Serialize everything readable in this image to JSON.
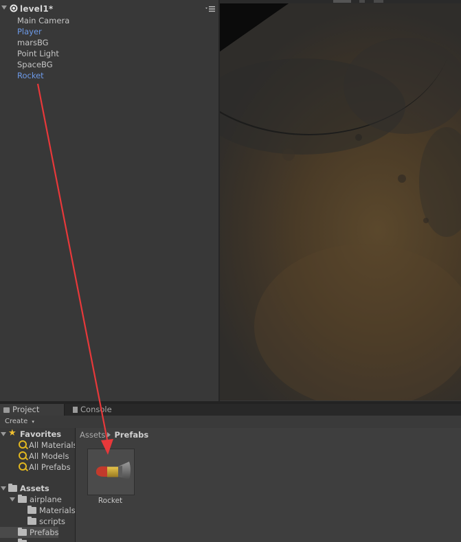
{
  "hierarchy": {
    "scene_title": "level1*",
    "menu_icon": "dropdown-menu-icon",
    "items": [
      {
        "label": "Main Camera",
        "kind": "normal"
      },
      {
        "label": "Player",
        "kind": "prefab"
      },
      {
        "label": "marsBG",
        "kind": "normal"
      },
      {
        "label": "Point Light",
        "kind": "normal"
      },
      {
        "label": "SpaceBG",
        "kind": "normal"
      },
      {
        "label": "Rocket",
        "kind": "prefab"
      }
    ]
  },
  "tabs": {
    "project": "Project",
    "console": "Console"
  },
  "toolbar": {
    "create": "Create"
  },
  "favorites": {
    "label": "Favorites",
    "items": [
      "All Materials",
      "All Models",
      "All Prefabs"
    ]
  },
  "assets": {
    "label": "Assets",
    "children": [
      {
        "label": "airplane"
      },
      {
        "label": "Materials"
      },
      {
        "label": "scripts"
      },
      {
        "label": "Prefabs"
      }
    ]
  },
  "breadcrumb": {
    "root": "Assets",
    "current": "Prefabs"
  },
  "asset_grid": {
    "items": [
      {
        "label": "Rocket"
      }
    ]
  },
  "colors": {
    "prefab_text": "#6d9ae8",
    "annotation_arrow": "#e8383a",
    "favorites_star": "#f0c030"
  }
}
